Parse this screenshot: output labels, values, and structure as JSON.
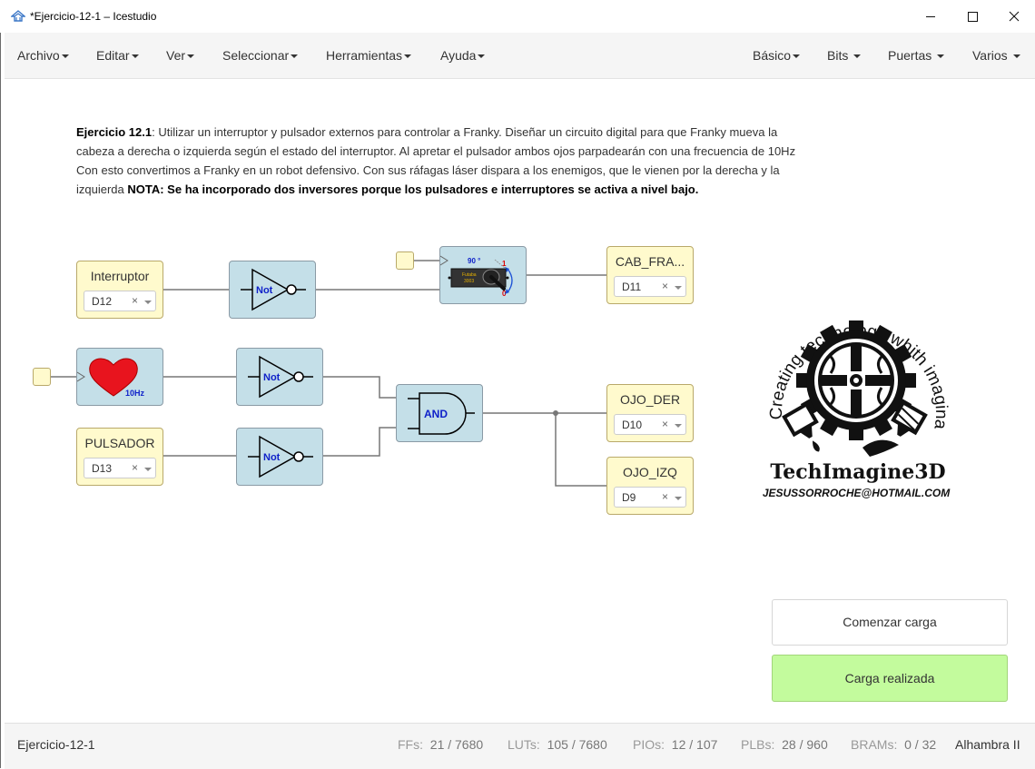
{
  "window": {
    "title": "*Ejercicio-12-1 – Icestudio"
  },
  "menu_left": [
    "Archivo",
    "Editar",
    "Ver",
    "Seleccionar",
    "Herramientas",
    "Ayuda"
  ],
  "menu_right": [
    "Básico",
    "Bits",
    "Puertas",
    "Varios"
  ],
  "description": {
    "title": "Ejercicio 12.1",
    "text": ": Utilizar un interruptor y pulsador externos para controlar a Franky. Diseñar un circuito digital para que Franky mueva la cabeza a derecha o izquierda según el estado del interruptor. Al apretar el pulsador ambos ojos parpadearán con una frecuencia de 10Hz Con esto convertimos a Franky en un robot defensivo. Con sus ráfagas láser dispara a los enemigos, que le vienen por la derecha y la izquierda ",
    "note": "NOTA: Se ha incorporado dos inversores porque los pulsadores e interruptores se activa a nivel bajo."
  },
  "blocks": {
    "interruptor": {
      "label": "Interruptor",
      "pin": "D12"
    },
    "pulsador": {
      "label": "PULSADOR",
      "pin": "D13"
    },
    "cab_franky": {
      "label": "CAB_FRA...",
      "pin": "D11"
    },
    "ojo_der": {
      "label": "OJO_DER",
      "pin": "D10"
    },
    "ojo_izq": {
      "label": "OJO_IZQ",
      "pin": "D9"
    },
    "not_label": "Not",
    "and_label": "AND",
    "heart_freq": "10Hz",
    "servo": {
      "angle": "90 °",
      "one": "1",
      "zero": "0",
      "brand": "Futaba",
      "model": "3003"
    }
  },
  "logo": {
    "arc_text": "Creating technology whith imagination",
    "name": "TechImagine3D",
    "email": "JESUSSORROCHE@HOTMAIL.COM"
  },
  "buttons": {
    "comenzar": "Comenzar carga",
    "carga": "Carga realizada"
  },
  "status": {
    "file": "Ejercicio-12-1",
    "ffs_label": "FFs:",
    "ffs": "21 / 7680",
    "luts_label": "LUTs:",
    "luts": "105 / 7680",
    "pios_label": "PIOs:",
    "pios": "12 / 107",
    "plbs_label": "PLBs:",
    "plbs": "28 / 960",
    "brams_label": "BRAMs:",
    "brams": "0 / 32",
    "board": "Alhambra II"
  },
  "colors": {
    "io_block": "#fffacd",
    "gate_block": "#c4dfe8",
    "success_button": "#c3fb9d",
    "heart": "#e8141e",
    "gate_text": "#0f21c9"
  }
}
